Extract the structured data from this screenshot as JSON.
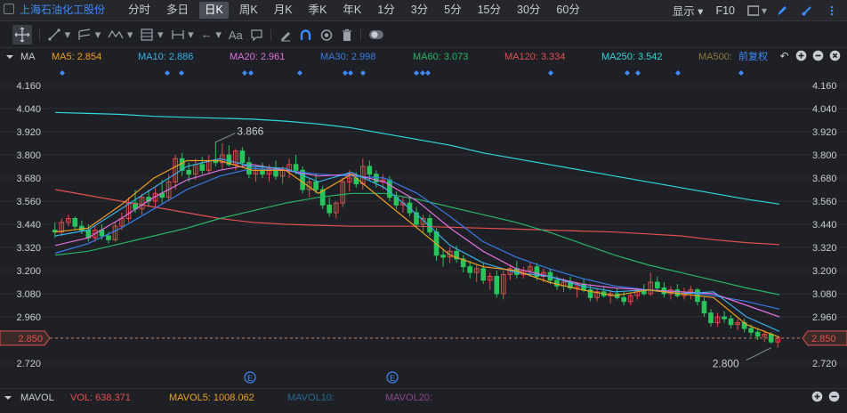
{
  "stock": {
    "name": "上海石油化工股份"
  },
  "periods": [
    "分时",
    "多日",
    "日K",
    "周K",
    "月K",
    "季K",
    "年K",
    "1分",
    "3分",
    "5分",
    "15分",
    "30分",
    "60分"
  ],
  "active_period": "日K",
  "toolbar_right": {
    "display_label": "显示",
    "f10_label": "F10"
  },
  "ma_legend": {
    "label": "MA",
    "items": [
      {
        "text": "MA5: 2.854",
        "color": "#f0a020"
      },
      {
        "text": "MA10: 2.886",
        "color": "#38b0e8"
      },
      {
        "text": "MA20: 2.961",
        "color": "#e070e0"
      },
      {
        "text": "MA30: 2.998",
        "color": "#3a7be8"
      },
      {
        "text": "MA60: 3.073",
        "color": "#28b468"
      },
      {
        "text": "MA120: 3.334",
        "color": "#e05050"
      },
      {
        "text": "MA250: 3.542",
        "color": "#30d8d8"
      },
      {
        "text": "MA500:",
        "color": "#8a7a40"
      }
    ],
    "adjust_label": "前复权"
  },
  "price_tag": {
    "left": "2.850",
    "right": "2.850"
  },
  "annotations": {
    "high": "3.866",
    "low": "2.800",
    "event_marker": "E"
  },
  "volume_legend": {
    "label": "MAVOL",
    "items": [
      {
        "text": "VOL: 638.371",
        "color": "#e05050"
      },
      {
        "text": "MAVOL5: 1008.062",
        "color": "#f0a020"
      },
      {
        "text": "MAVOL10:",
        "color": "#2a6a8a"
      },
      {
        "text": "MAVOL20:",
        "color": "#8a4a8a"
      }
    ]
  },
  "chart_data": {
    "type": "candlestick",
    "y_ticks": [
      "4.160",
      "4.040",
      "3.920",
      "3.800",
      "3.680",
      "3.560",
      "3.440",
      "3.320",
      "3.200",
      "3.080",
      "2.960",
      "2.850",
      "2.720"
    ],
    "ylim": [
      2.68,
      4.21
    ],
    "up_color": "#e24b4b",
    "down_color": "#2ac45c",
    "candles": [
      [
        3.41,
        3.45,
        3.37,
        3.4
      ],
      [
        3.4,
        3.47,
        3.38,
        3.45
      ],
      [
        3.45,
        3.49,
        3.43,
        3.47
      ],
      [
        3.47,
        3.48,
        3.41,
        3.43
      ],
      [
        3.43,
        3.46,
        3.39,
        3.41
      ],
      [
        3.41,
        3.44,
        3.35,
        3.37
      ],
      [
        3.37,
        3.43,
        3.35,
        3.41
      ],
      [
        3.41,
        3.44,
        3.36,
        3.38
      ],
      [
        3.38,
        3.4,
        3.34,
        3.36
      ],
      [
        3.36,
        3.45,
        3.35,
        3.43
      ],
      [
        3.43,
        3.5,
        3.41,
        3.47
      ],
      [
        3.47,
        3.58,
        3.45,
        3.55
      ],
      [
        3.55,
        3.62,
        3.5,
        3.52
      ],
      [
        3.52,
        3.6,
        3.49,
        3.58
      ],
      [
        3.58,
        3.62,
        3.53,
        3.56
      ],
      [
        3.56,
        3.63,
        3.52,
        3.6
      ],
      [
        3.6,
        3.67,
        3.55,
        3.58
      ],
      [
        3.58,
        3.7,
        3.56,
        3.66
      ],
      [
        3.66,
        3.8,
        3.62,
        3.78
      ],
      [
        3.78,
        3.81,
        3.69,
        3.72
      ],
      [
        3.72,
        3.76,
        3.66,
        3.7
      ],
      [
        3.7,
        3.78,
        3.67,
        3.75
      ],
      [
        3.75,
        3.79,
        3.7,
        3.72
      ],
      [
        3.72,
        3.8,
        3.7,
        3.77
      ],
      [
        3.77,
        3.87,
        3.74,
        3.76
      ],
      [
        3.76,
        3.86,
        3.72,
        3.8
      ],
      [
        3.8,
        3.85,
        3.74,
        3.75
      ],
      [
        3.75,
        3.83,
        3.72,
        3.82
      ],
      [
        3.82,
        3.84,
        3.74,
        3.76
      ],
      [
        3.76,
        3.79,
        3.68,
        3.7
      ],
      [
        3.7,
        3.74,
        3.66,
        3.72
      ],
      [
        3.72,
        3.76,
        3.68,
        3.7
      ],
      [
        3.7,
        3.75,
        3.66,
        3.73
      ],
      [
        3.73,
        3.77,
        3.67,
        3.69
      ],
      [
        3.69,
        3.74,
        3.65,
        3.72
      ],
      [
        3.72,
        3.78,
        3.68,
        3.75
      ],
      [
        3.75,
        3.8,
        3.7,
        3.72
      ],
      [
        3.72,
        3.74,
        3.6,
        3.62
      ],
      [
        3.62,
        3.68,
        3.58,
        3.66
      ],
      [
        3.66,
        3.7,
        3.6,
        3.62
      ],
      [
        3.62,
        3.64,
        3.52,
        3.54
      ],
      [
        3.54,
        3.58,
        3.48,
        3.5
      ],
      [
        3.5,
        3.56,
        3.47,
        3.55
      ],
      [
        3.55,
        3.68,
        3.53,
        3.66
      ],
      [
        3.66,
        3.72,
        3.61,
        3.68
      ],
      [
        3.68,
        3.71,
        3.63,
        3.65
      ],
      [
        3.65,
        3.78,
        3.62,
        3.74
      ],
      [
        3.74,
        3.77,
        3.67,
        3.7
      ],
      [
        3.7,
        3.72,
        3.63,
        3.66
      ],
      [
        3.66,
        3.7,
        3.62,
        3.67
      ],
      [
        3.67,
        3.69,
        3.56,
        3.58
      ],
      [
        3.58,
        3.61,
        3.52,
        3.54
      ],
      [
        3.54,
        3.58,
        3.5,
        3.55
      ],
      [
        3.55,
        3.58,
        3.48,
        3.5
      ],
      [
        3.5,
        3.53,
        3.42,
        3.44
      ],
      [
        3.44,
        3.49,
        3.4,
        3.47
      ],
      [
        3.47,
        3.49,
        3.38,
        3.4
      ],
      [
        3.4,
        3.42,
        3.25,
        3.28
      ],
      [
        3.28,
        3.31,
        3.22,
        3.27
      ],
      [
        3.27,
        3.32,
        3.24,
        3.3
      ],
      [
        3.3,
        3.33,
        3.24,
        3.26
      ],
      [
        3.26,
        3.28,
        3.19,
        3.22
      ],
      [
        3.22,
        3.25,
        3.16,
        3.19
      ],
      [
        3.19,
        3.23,
        3.14,
        3.21
      ],
      [
        3.21,
        3.24,
        3.13,
        3.15
      ],
      [
        3.15,
        3.19,
        3.1,
        3.17
      ],
      [
        3.17,
        3.2,
        3.06,
        3.08
      ],
      [
        3.08,
        3.2,
        3.05,
        3.18
      ],
      [
        3.18,
        3.23,
        3.15,
        3.21
      ],
      [
        3.21,
        3.25,
        3.16,
        3.18
      ],
      [
        3.18,
        3.22,
        3.16,
        3.2
      ],
      [
        3.2,
        3.24,
        3.17,
        3.22
      ],
      [
        3.22,
        3.24,
        3.15,
        3.17
      ],
      [
        3.17,
        3.21,
        3.14,
        3.19
      ],
      [
        3.19,
        3.21,
        3.13,
        3.15
      ],
      [
        3.15,
        3.17,
        3.1,
        3.12
      ],
      [
        3.12,
        3.16,
        3.09,
        3.14
      ],
      [
        3.14,
        3.17,
        3.1,
        3.11
      ],
      [
        3.11,
        3.14,
        3.06,
        3.13
      ],
      [
        3.13,
        3.16,
        3.09,
        3.1
      ],
      [
        3.1,
        3.13,
        3.04,
        3.06
      ],
      [
        3.06,
        3.11,
        3.04,
        3.09
      ],
      [
        3.09,
        3.12,
        3.06,
        3.07
      ],
      [
        3.07,
        3.1,
        3.03,
        3.08
      ],
      [
        3.08,
        3.11,
        3.05,
        3.06
      ],
      [
        3.06,
        3.09,
        3.02,
        3.04
      ],
      [
        3.04,
        3.08,
        3.02,
        3.07
      ],
      [
        3.07,
        3.11,
        3.05,
        3.1
      ],
      [
        3.1,
        3.13,
        3.07,
        3.08
      ],
      [
        3.08,
        3.19,
        3.07,
        3.14
      ],
      [
        3.14,
        3.17,
        3.09,
        3.11
      ],
      [
        3.11,
        3.14,
        3.06,
        3.08
      ],
      [
        3.08,
        3.12,
        3.05,
        3.1
      ],
      [
        3.1,
        3.13,
        3.06,
        3.07
      ],
      [
        3.07,
        3.11,
        3.05,
        3.09
      ],
      [
        3.09,
        3.12,
        3.05,
        3.1
      ],
      [
        3.1,
        3.11,
        3.02,
        3.04
      ],
      [
        3.04,
        3.06,
        2.96,
        2.98
      ],
      [
        2.98,
        3.0,
        2.91,
        2.93
      ],
      [
        2.93,
        2.98,
        2.91,
        2.96
      ],
      [
        2.96,
        2.99,
        2.93,
        2.95
      ],
      [
        2.95,
        2.97,
        2.9,
        2.92
      ],
      [
        2.92,
        2.95,
        2.89,
        2.93
      ],
      [
        2.93,
        2.95,
        2.88,
        2.9
      ],
      [
        2.9,
        2.92,
        2.86,
        2.88
      ],
      [
        2.88,
        2.9,
        2.84,
        2.86
      ],
      [
        2.86,
        2.89,
        2.83,
        2.87
      ],
      [
        2.87,
        2.88,
        2.82,
        2.83
      ],
      [
        2.83,
        2.86,
        2.8,
        2.85
      ]
    ],
    "ma_lines": [
      {
        "name": "MA250",
        "color": "#30d8d8",
        "values": [
          4.02,
          4.015,
          4.01,
          4.0,
          3.995,
          3.99,
          3.985,
          3.975,
          3.96,
          3.94,
          3.91,
          3.88,
          3.85,
          3.81,
          3.78,
          3.75,
          3.72,
          3.69,
          3.66,
          3.63,
          3.6,
          3.57,
          3.545
        ]
      },
      {
        "name": "MA120",
        "color": "#e05050",
        "values": [
          3.62,
          3.59,
          3.56,
          3.53,
          3.5,
          3.47,
          3.45,
          3.44,
          3.435,
          3.43,
          3.43,
          3.43,
          3.425,
          3.42,
          3.415,
          3.41,
          3.405,
          3.4,
          3.39,
          3.38,
          3.36,
          3.345,
          3.335
        ]
      },
      {
        "name": "MA60",
        "color": "#28b468",
        "values": [
          3.28,
          3.3,
          3.34,
          3.38,
          3.42,
          3.47,
          3.51,
          3.55,
          3.58,
          3.6,
          3.6,
          3.57,
          3.53,
          3.49,
          3.45,
          3.4,
          3.34,
          3.28,
          3.23,
          3.19,
          3.15,
          3.11,
          3.075
        ]
      },
      {
        "name": "MA30",
        "color": "#3a7be8",
        "values": [
          3.29,
          3.34,
          3.42,
          3.52,
          3.62,
          3.69,
          3.73,
          3.72,
          3.7,
          3.69,
          3.68,
          3.6,
          3.48,
          3.35,
          3.27,
          3.21,
          3.16,
          3.12,
          3.1,
          3.09,
          3.07,
          3.04,
          3.0
        ]
      },
      {
        "name": "MA20",
        "color": "#e070e0",
        "values": [
          3.33,
          3.37,
          3.47,
          3.58,
          3.67,
          3.72,
          3.75,
          3.72,
          3.69,
          3.7,
          3.66,
          3.56,
          3.42,
          3.3,
          3.21,
          3.17,
          3.13,
          3.11,
          3.1,
          3.09,
          3.08,
          3.02,
          2.96
        ]
      },
      {
        "name": "MA10",
        "color": "#38b0e8",
        "values": [
          3.38,
          3.41,
          3.52,
          3.63,
          3.74,
          3.78,
          3.74,
          3.73,
          3.66,
          3.71,
          3.63,
          3.49,
          3.33,
          3.24,
          3.19,
          3.17,
          3.12,
          3.09,
          3.1,
          3.08,
          3.09,
          2.96,
          2.885
        ]
      },
      {
        "name": "MA5",
        "color": "#f0a020",
        "values": [
          3.4,
          3.42,
          3.54,
          3.68,
          3.77,
          3.77,
          3.72,
          3.72,
          3.6,
          3.7,
          3.56,
          3.42,
          3.28,
          3.22,
          3.2,
          3.14,
          3.1,
          3.07,
          3.1,
          3.08,
          3.06,
          2.92,
          2.855
        ]
      }
    ],
    "ma_x_span": [
      0.0,
      1.0
    ]
  }
}
